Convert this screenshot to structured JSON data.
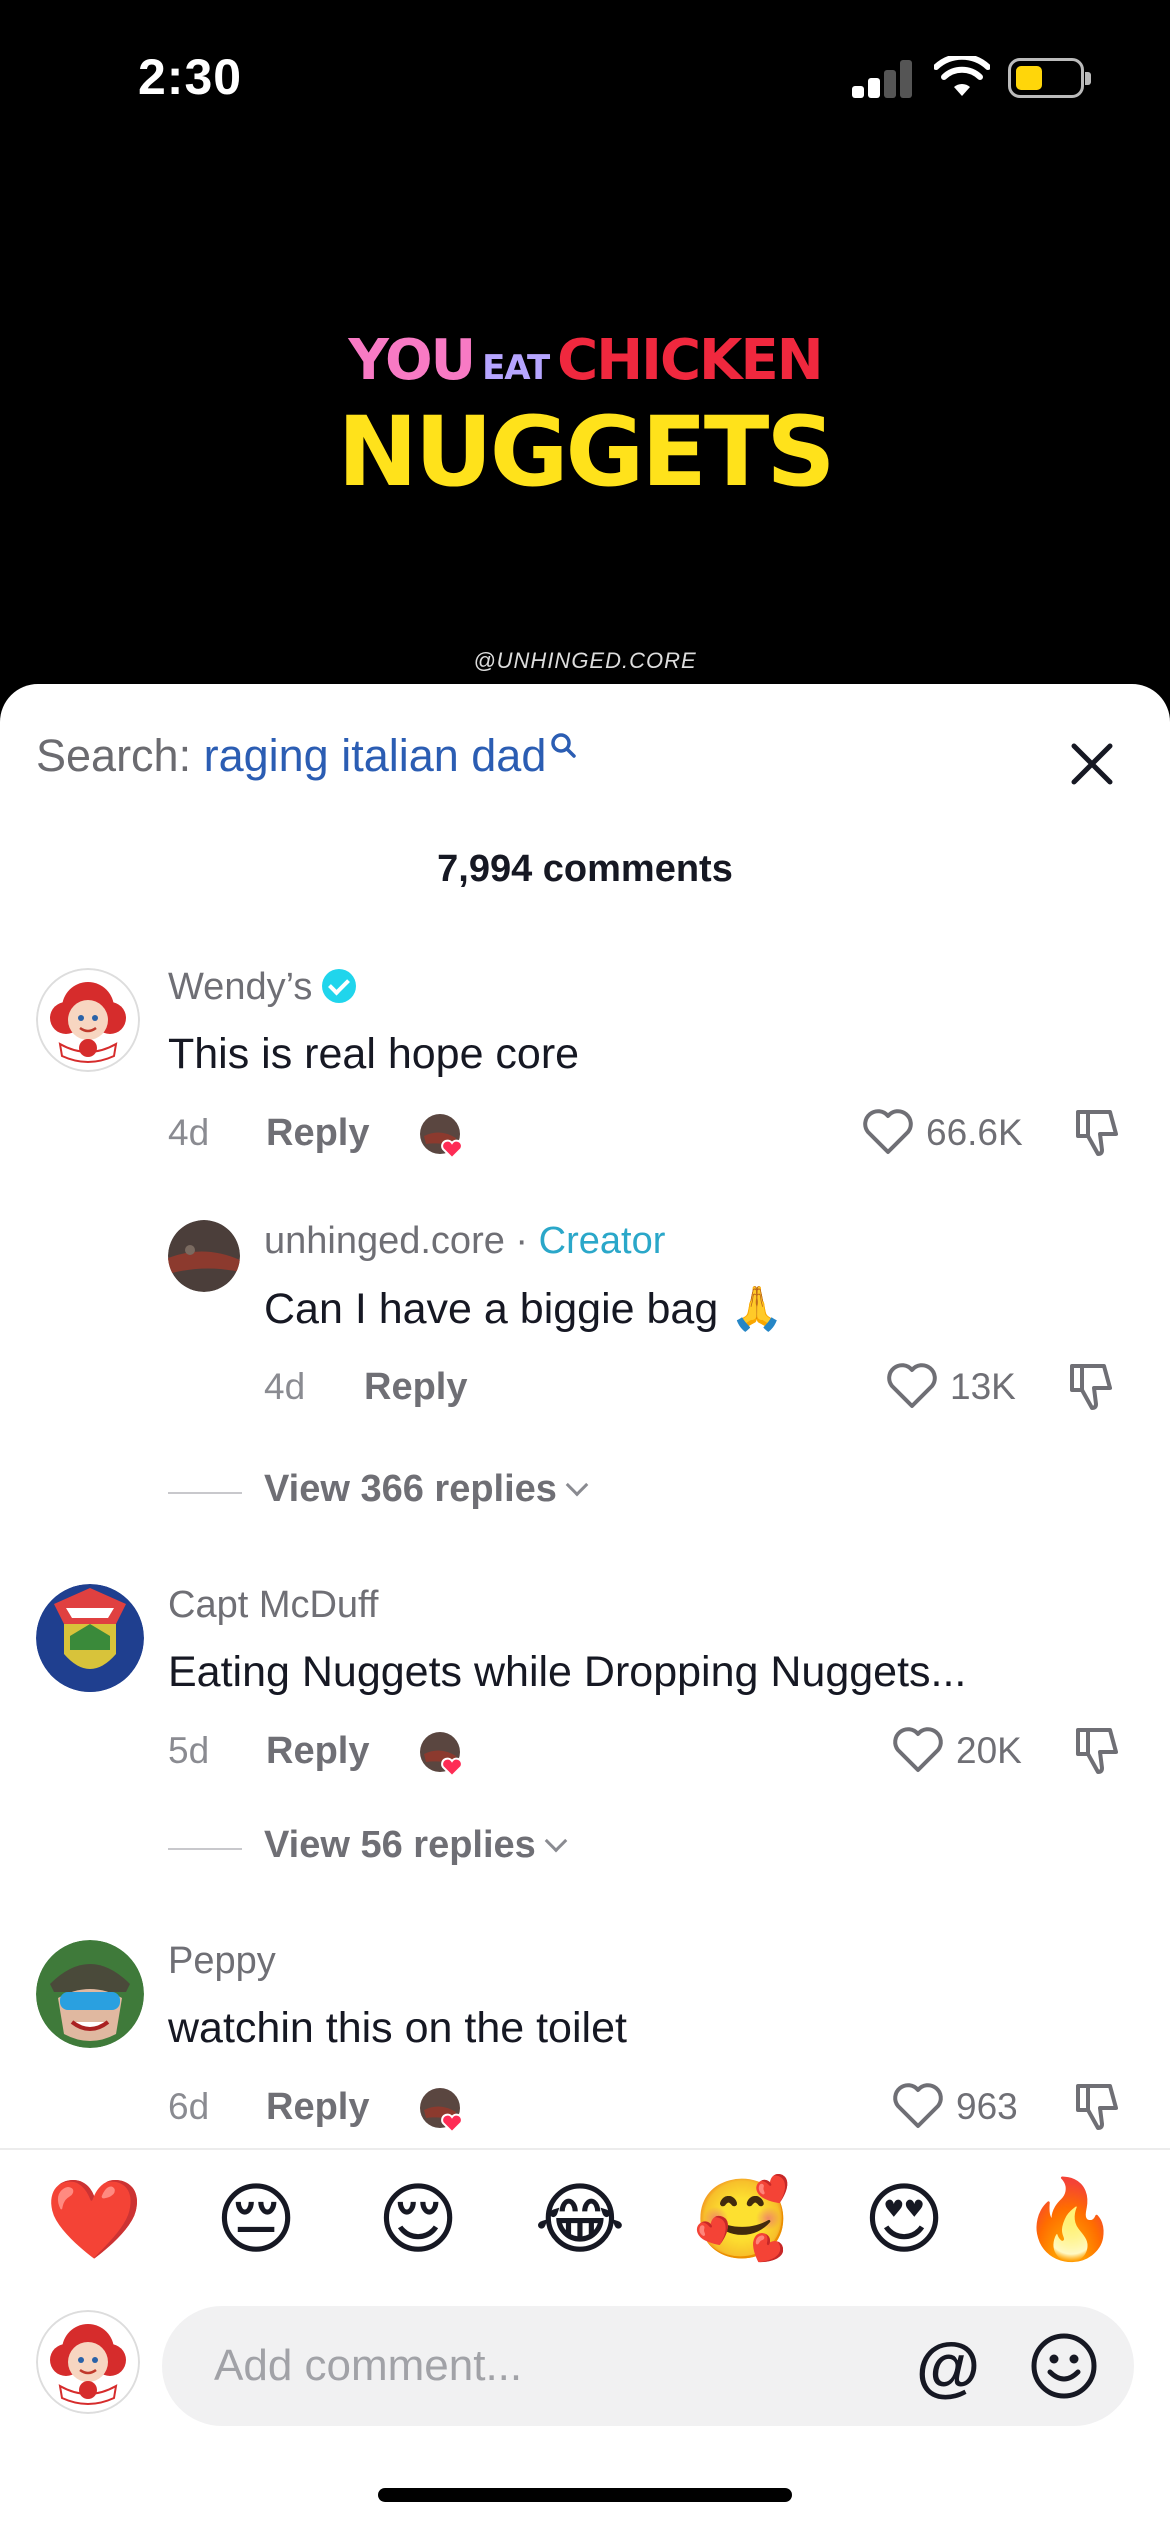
{
  "status_bar": {
    "time": "2:30"
  },
  "video": {
    "line1": {
      "you": "YOU",
      "eat": "EAT",
      "chicken": "CHICKEN"
    },
    "line2": "NUGGETS",
    "watermark": "@UNHINGED.CORE"
  },
  "search": {
    "label": "Search:",
    "query": "raging italian dad"
  },
  "comment_count": "7,994 comments",
  "comments": [
    {
      "username": "Wendy’s",
      "verified": true,
      "text": "This is real hope core",
      "age": "4d",
      "reply_label": "Reply",
      "likes": "66.6K",
      "creator_liked": true
    },
    {
      "username": "unhinged.core",
      "separator": " · ",
      "badge": "Creator",
      "text": "Can I have a biggie bag 🙏",
      "age": "4d",
      "reply_label": "Reply",
      "likes": "13K"
    },
    {
      "username": "Capt McDuff",
      "text": "Eating Nuggets while Dropping Nuggets...",
      "age": "5d",
      "reply_label": "Reply",
      "likes": "20K",
      "creator_liked": true
    },
    {
      "username": "Peppy",
      "text": "watchin this on the toilet",
      "age": "6d",
      "reply_label": "Reply",
      "likes": "963",
      "creator_liked": true
    }
  ],
  "view_replies": [
    "View 366 replies",
    "View 56 replies"
  ],
  "quick_emojis": [
    {
      "name": "red-heart",
      "glyph": "❤️"
    },
    {
      "name": "pensive-face",
      "glyph": "😔"
    },
    {
      "name": "relieved-face",
      "glyph": "😌"
    },
    {
      "name": "tears-of-joy-face",
      "glyph": "😂"
    },
    {
      "name": "smiling-face-with-hearts",
      "glyph": "🥰"
    },
    {
      "name": "heart-eyes-face",
      "glyph": "😍"
    },
    {
      "name": "fire",
      "glyph": "🔥"
    }
  ],
  "composer": {
    "placeholder": "Add comment...",
    "at_symbol": "@"
  },
  "colors": {
    "link_blue": "#2b5db3",
    "creator_teal": "#2aa7c9",
    "verified": "#20d5ec",
    "muted": "#6f6f75"
  }
}
